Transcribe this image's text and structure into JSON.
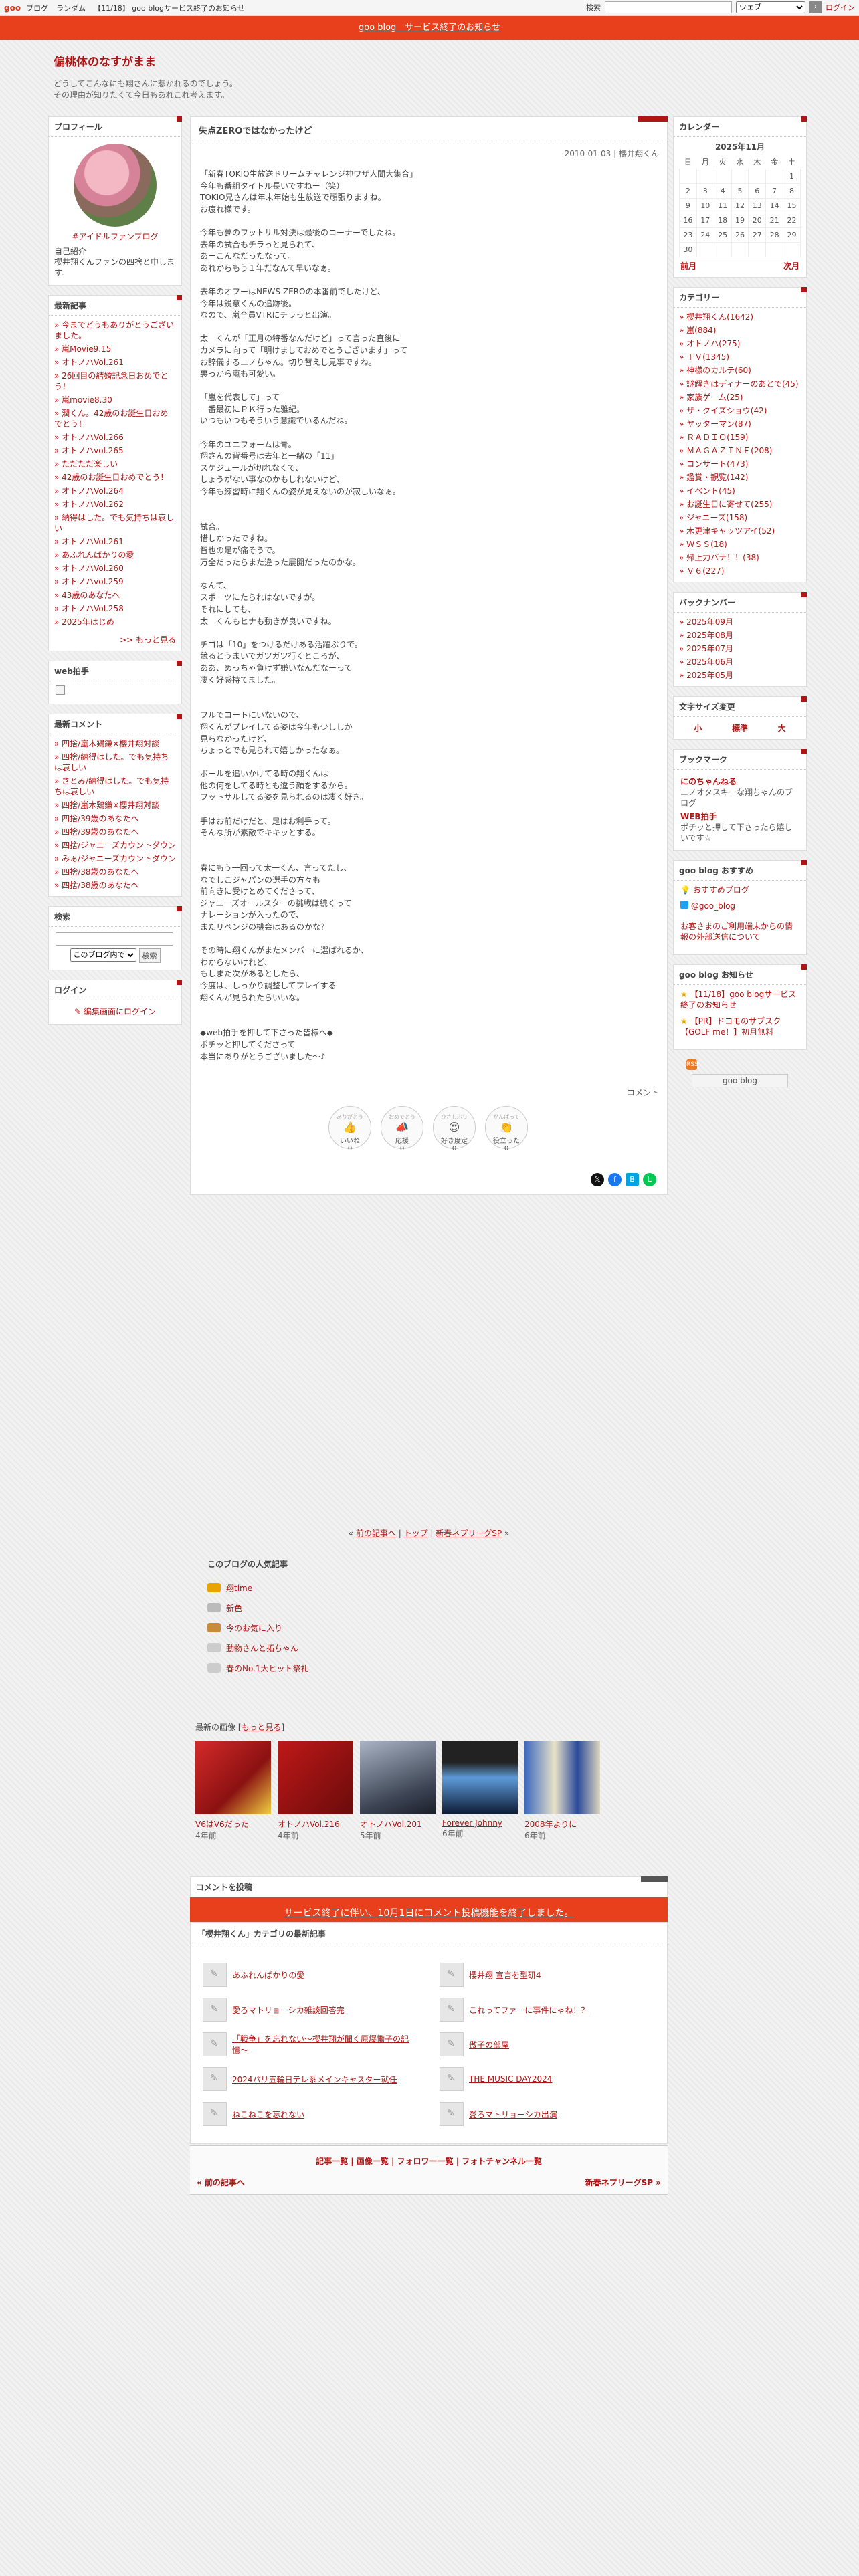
{
  "topbar": {
    "logo": "goo",
    "links": [
      "ブログ",
      "ランダム",
      "【11/18】 goo blogサービス終了のお知らせ"
    ],
    "search_label": "検索",
    "search_select": "ウェブ",
    "login": "ログイン"
  },
  "banner": "goo blog　サービス終了のお知らせ",
  "blog": {
    "title": "偏桃体のなすがまま",
    "desc1": "どうしてこんなにも翔さんに惹かれるのでしょう。",
    "desc2": "その理由が知りたくて今日もあれこれ考えます。"
  },
  "profile": {
    "title": "プロフィール",
    "name": "#アイドルファンブログ",
    "intro1": "自己紹介",
    "intro2": "櫻井翔くんファンの四捨と申します。"
  },
  "latest": {
    "title": "最新記事",
    "items": [
      "今までどうもありがとうございました。",
      "嵐Movie9.15",
      "オトノハVol.261",
      "26回目の結婚記念日おめでとう！",
      "嵐movie8.30",
      "潤くん。42歳のお誕生日おめでとう！",
      "オトノハVol.266",
      "オトノハvol.265",
      "ただただ楽しい",
      "42歳のお誕生日おめでとう！",
      "オトノハVol.264",
      "オトノハVol.262",
      "納得はした。でも気持ちは哀しい",
      "オトノハVol.261",
      "あふれんばかりの愛",
      "オトノハVol.260",
      "オトノハvol.259",
      "43歳のあなたへ",
      "オトノハVol.258",
      "2025年はじめ"
    ],
    "more": ">> もっと見る"
  },
  "webclap": {
    "title": "web拍手"
  },
  "comments": {
    "title": "最新コメント",
    "items": [
      "四捨/嵐木鶏鎌×櫻井翔対談",
      "四捨/納得はした。でも気持ちは哀しい",
      "さとみ/納得はした。でも気持ちは哀しい",
      "四捨/嵐木鶏鎌×櫻井翔対談",
      "四捨/39歳のあなたへ",
      "四捨/39歳のあなたへ",
      "四捨/ジャニーズカウントダウン",
      "みぁ/ジャニーズカウントダウン",
      "四捨/38歳のあなたへ",
      "四捨/38歳のあなたへ"
    ]
  },
  "search": {
    "title": "検索",
    "scope": "このブログ内で",
    "button": "検索"
  },
  "login": {
    "title": "ログイン",
    "link": "編集画面にログイン"
  },
  "article": {
    "title": "失点ZEROではなかったけど",
    "meta": "2010-01-03 | 櫻井翔くん",
    "paragraphs": [
      [
        "「新春TOKIO生放送ドリームチャレンジ神ワザ人間大集合」",
        "今年も番組タイトル長いですねー（笑）",
        "TOKIO兄さんは年末年始も生放送で頑張りますね。",
        "お疲れ様です。"
      ],
      [
        "今年も夢のフットサル対決は最後のコーナーでしたね。",
        "去年の試合もチラっと見られて、",
        "あーこんなだったなって。",
        "あれからもう１年だなんて早いなぁ。"
      ],
      [
        "去年のオフーはNEWS ZEROの本番前でしたけど、",
        "今年は鋭意くんの追跡後。",
        "なので、嵐全員VTRにチラっと出演。"
      ],
      [
        "太一くんが「正月の特番なんだけど」って言った直後に",
        "カメラに向って「明けましておめでとうございます」って",
        "お辞儀するニノちゃん。切り替えし見事ですね。",
        "裏っから嵐も可愛い。"
      ],
      [
        "「嵐を代表して」って",
        "一番最初にＰＫ行った雅紀。",
        "いつもいつもそういう意識でいるんだね。"
      ],
      [
        "今年のユニフォームは青。",
        "翔さんの背番号は去年と一緒の「11」",
        "スケジュールが切れなくて、",
        "しょうがない事なのかもしれないけど、",
        "今年も練習時に翔くんの姿が見えないのが寂しいなぁ。"
      ],
      [
        " ",
        "試合。",
        "惜しかったですね。",
        "智也の足が痛そうで。",
        "万全だったらまた違った展開だったのかな。"
      ],
      [
        "なんて、",
        "スポーツにたられはないですが。",
        "それにしても、",
        "太一くんもヒナも動きが良いですね。"
      ],
      [
        "チゴは「10」をつけるだけある活躍ぶりで。",
        "競るとうまいでガツガツ行くところが、",
        "ああ、めっちゃ負けず嫌いなんだなーって",
        "凄く好感持てました。"
      ],
      [
        " ",
        "フルでコートにいないので、",
        "翔くんがプレイしてる姿は今年も少ししか",
        "見らなかったけど、",
        "ちょっとでも見られて嬉しかったなぁ。"
      ],
      [
        "ボールを追いかけてる時の翔くんは",
        "他の何をしてる時とも違う顔をするから。",
        "フットサルしてる姿を見られるのは凄く好き。"
      ],
      [
        "手はお前だけだと、足はお利手って。",
        "そんな所が素敵でキキッとする。"
      ],
      [
        " ",
        "春にもう一回って太一くん、言ってたし、",
        "なでしこジャパンの選手の方々も",
        "前向きに受けとめてくださって、",
        "ジャニーズオールスターの挑戦は続くって",
        "ナレーションが入ったので、",
        "またリベンジの機会はあるのかな？"
      ],
      [
        "その時に翔くんがまたメンバーに選ばれるか、",
        "わからないけれど、",
        "もしまた次があるとしたら、",
        "今度は、しっかり調整してプレイする",
        "翔くんが見られたらいいな。"
      ],
      [
        " ",
        "◆web拍手を押して下さった皆様へ◆",
        "ポチッと押してくださって",
        "本当にありがとうございました〜♪"
      ]
    ],
    "comment_label": "コメント",
    "reactions": [
      {
        "label": "いいね",
        "sub": "ありがとう",
        "count": "0"
      },
      {
        "label": "応援",
        "sub": "おめでとう",
        "count": "0"
      },
      {
        "label": "好き度定",
        "sub": "ひさしぶり",
        "count": "0"
      },
      {
        "label": "役立った",
        "sub": "がんばって",
        "count": "0"
      }
    ]
  },
  "pager": {
    "prev": "前の記事へ",
    "top": "トップ",
    "next": "新春ネプリーグSP"
  },
  "popular": {
    "title": "このブログの人気記事",
    "items": [
      "翔time",
      "新色",
      "今のお気に入り",
      "動物さんと拓ちゃん",
      "春のNo.1大ヒット祭礼"
    ]
  },
  "recent_images": {
    "title": "最新の画像",
    "more": "もっと見る",
    "items": [
      {
        "cap": "V6はV6だった",
        "age": "4年前"
      },
      {
        "cap": "オトノハVol.216",
        "age": "4年前"
      },
      {
        "cap": "オトノハVol.201",
        "age": "5年前"
      },
      {
        "cap": "Forever Johnny",
        "age": "6年前"
      },
      {
        "cap": "2008年よりに",
        "age": "6年前"
      }
    ]
  },
  "comment_post": {
    "title": "コメントを投稿",
    "closed": "サービス終了に伴い、10月1日にコメント投稿機能を終了しました。"
  },
  "category": {
    "title": "「櫻井翔くん」カテゴリの最新記事",
    "items": [
      "あふれんばかりの愛",
      "櫻井翔 宣言を型研4",
      "愛ろマトリョーシカ雑談回答完",
      "これってファーに事件にゃね！？",
      "「戦争」を忘れない〜櫻井翔が聞く原爆慟子の記憶〜",
      "傲子の部屋",
      "2024パリ五輪日テレ系メインキャスター就任",
      "THE MUSIC DAY2024",
      "ねこねこを忘れない",
      "愛ろマトリョーシカ出演"
    ]
  },
  "footnav": {
    "links": "記事一覧 | 画像一覧 | フォロワー一覧 | フォトチャンネル一覧",
    "prev": "« 前の記事へ",
    "next": "新春ネプリーグSP »"
  },
  "calendar": {
    "title": "カレンダー",
    "month": "2025年11月",
    "weekdays": [
      "日",
      "月",
      "火",
      "水",
      "木",
      "金",
      "土"
    ],
    "weeks": [
      [
        "",
        "",
        "",
        "",
        "",
        "",
        "1"
      ],
      [
        "2",
        "3",
        "4",
        "5",
        "6",
        "7",
        "8"
      ],
      [
        "9",
        "10",
        "11",
        "12",
        "13",
        "14",
        "15"
      ],
      [
        "16",
        "17",
        "18",
        "19",
        "20",
        "21",
        "22"
      ],
      [
        "23",
        "24",
        "25",
        "26",
        "27",
        "28",
        "29"
      ],
      [
        "30",
        "",
        "",
        "",
        "",
        "",
        ""
      ]
    ],
    "prev": "前月",
    "next": "次月"
  },
  "categories": {
    "title": "カテゴリー",
    "items": [
      "櫻井翔くん(1642)",
      "嵐(884)",
      "オトノハ(275)",
      "ＴＶ(1345)",
      "神様のカルテ(60)",
      "謎解きはディナーのあとで(45)",
      "家族ゲーム(25)",
      "ザ・クイズショウ(42)",
      "ヤッターマン(87)",
      "ＲＡＤＩＯ(159)",
      "ＭＡＧＡＺＩＮＥ(208)",
      "コンサート(473)",
      "鑑賞・観覧(142)",
      "イベント(45)",
      "お誕生日に寄せて(255)",
      "ジャニーズ(158)",
      "木更津キャッツアイ(52)",
      "ＷＳＳ(18)",
      "帰上力バナ！！(38)",
      "Ｖ６(227)"
    ]
  },
  "backnumber": {
    "title": "バックナンバー",
    "items": [
      "2025年09月",
      "2025年08月",
      "2025年07月",
      "2025年06月",
      "2025年05月"
    ]
  },
  "fontsize": {
    "title": "文字サイズ変更",
    "small": "小",
    "medium": "標準",
    "large": "大"
  },
  "bookmarks": {
    "title": "ブックマーク",
    "items": [
      {
        "t": "にのちゃんねる",
        "s": "ニノオタスキーな翔ちゃんのブログ"
      },
      {
        "t": "WEB拍手",
        "s": "ポチッと押して下さったら嬉しいです☆"
      }
    ]
  },
  "recommend": {
    "title": "goo blog おすすめ",
    "items": [
      "おすすめブログ",
      "@goo_blog"
    ],
    "note": "お客さまのご利用端末からの情報の外部送信について"
  },
  "notice": {
    "title": "goo blog お知らせ",
    "items": [
      "【11/18】goo blogサービス終了のお知らせ",
      "【PR】ドコモのサブスク【GOLF me！】初月無料"
    ],
    "badge": "goo blog"
  },
  "colors": {
    "accent": "#b01515",
    "banner": "#e8401c"
  }
}
